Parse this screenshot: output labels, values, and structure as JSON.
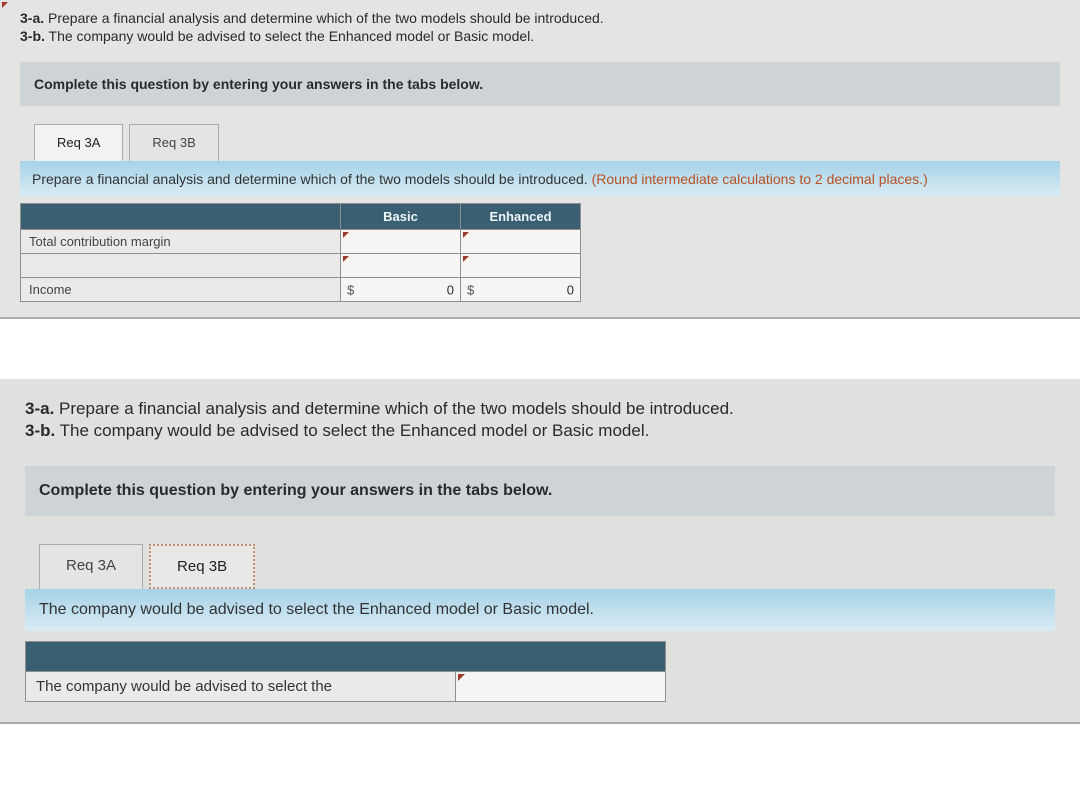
{
  "top": {
    "q3a_label": "3-a.",
    "q3a_text": "Prepare a financial analysis and determine which of the two models should be introduced.",
    "q3b_label": "3-b.",
    "q3b_text": "The company would be advised to select the Enhanced model or Basic model.",
    "complete_bar": "Complete this question by entering your answers in the tabs below.",
    "tabs": {
      "tab_a": "Req 3A",
      "tab_b": "Req 3B"
    },
    "tab_a": {
      "prompt": "Prepare a financial analysis and determine which of the two models should be introduced. ",
      "hint": "(Round intermediate calculations to 2 decimal places.)",
      "headers": {
        "basic": "Basic",
        "enhanced": "Enhanced"
      },
      "rows": {
        "tcm_label": "Total contribution margin",
        "blank_label": "",
        "income_label": "Income",
        "currency": "$",
        "income_basic": "0",
        "income_enhanced": "0"
      }
    }
  },
  "bottom": {
    "q3a_label": "3-a.",
    "q3a_text": "Prepare a financial analysis and determine which of the two models should be introduced.",
    "q3b_label": "3-b.",
    "q3b_text": "The company would be advised to select the Enhanced model or Basic model.",
    "complete_bar": "Complete this question by entering your answers in the tabs below.",
    "tabs": {
      "tab_a": "Req 3A",
      "tab_b": "Req 3B"
    },
    "tab_b": {
      "prompt": "The company would be advised to select the Enhanced model or Basic model.",
      "answer_label": "The company would be advised to select the"
    }
  }
}
